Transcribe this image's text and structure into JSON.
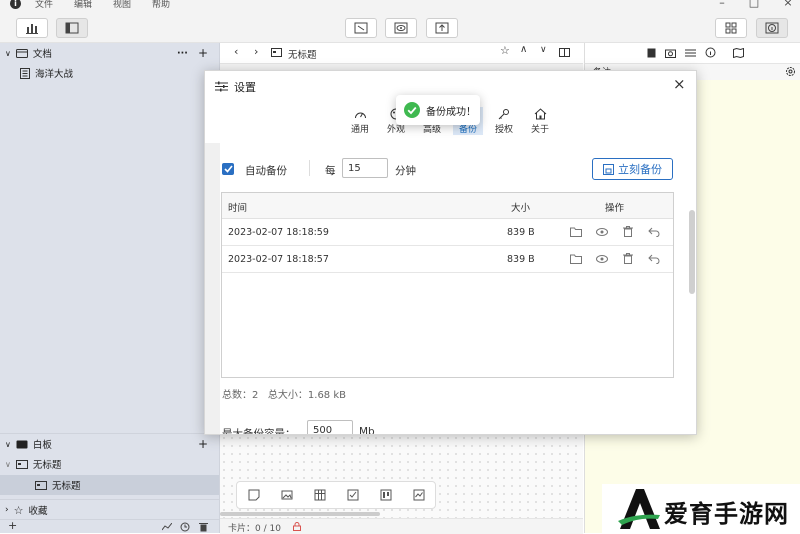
{
  "menubar": {
    "items": [
      "文件",
      "编辑",
      "视图",
      "帮助"
    ]
  },
  "sidebar": {
    "docs_section": {
      "label": "文档",
      "more": "···",
      "add": "+"
    },
    "doc_items": [
      {
        "label": "海洋大战"
      }
    ],
    "whiteboard_section": {
      "label": "白板",
      "add": "+"
    },
    "whiteboard_items": [
      {
        "label": "无标题",
        "level": 0,
        "selected": false
      },
      {
        "label": "无标题",
        "level": 1,
        "selected": true
      }
    ],
    "favorites_section": {
      "label": "收藏"
    },
    "bottom": {
      "add": "+"
    }
  },
  "editor": {
    "title": "无标题",
    "status": "卡片：0 / 10"
  },
  "right_panel": {
    "header": "备注"
  },
  "dialog": {
    "title": "设置",
    "close": "×",
    "tabs": [
      {
        "label": "通用",
        "icon": "gauge-icon",
        "active": false
      },
      {
        "label": "外观",
        "icon": "palette-icon",
        "active": false
      },
      {
        "label": "高级",
        "icon": "sliders-icon",
        "active": false
      },
      {
        "label": "备份",
        "icon": "database-icon",
        "active": true
      },
      {
        "label": "授权",
        "icon": "key-icon",
        "active": false
      },
      {
        "label": "关于",
        "icon": "home-icon",
        "active": false
      }
    ],
    "auto_backup": {
      "checked": true,
      "label": "自动备份",
      "every": "每",
      "interval": "15",
      "unit": "分钟"
    },
    "backup_now": "立刻备份",
    "table": {
      "headers": {
        "time": "时间",
        "size": "大小",
        "actions": "操作"
      },
      "rows": [
        {
          "time": "2023-02-07 18:18:59",
          "size": "839 B"
        },
        {
          "time": "2023-02-07 18:18:57",
          "size": "839 B"
        }
      ]
    },
    "summary": "总数：2   总大小：1.68 kB",
    "max_capacity": {
      "label": "最大备份容量：",
      "value": "500",
      "unit": "Mb"
    }
  },
  "toast": {
    "message": "备份成功！"
  },
  "watermark": {
    "text": "爱育手游网"
  },
  "colors": {
    "accent": "#2a6fc2",
    "success": "#3fb950",
    "sidebar_bg": "#dde1ea",
    "notes_bg": "#fdfde8"
  }
}
